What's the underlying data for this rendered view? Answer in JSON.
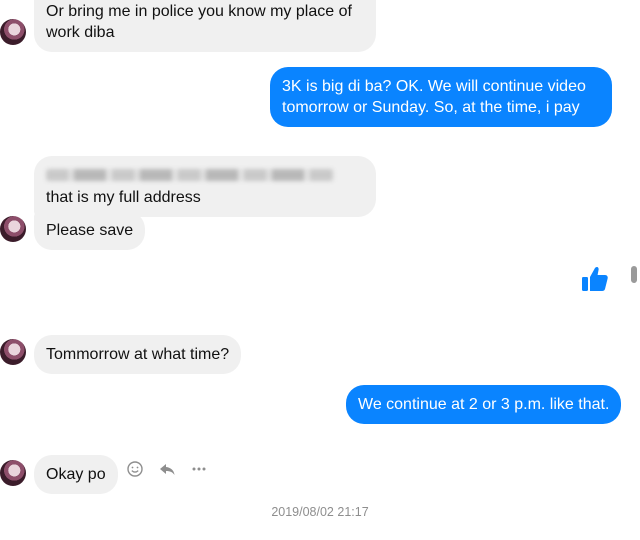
{
  "messages": {
    "m1": {
      "sender": "them",
      "text": "Or bring me in police you know my place of work diba"
    },
    "m2": {
      "sender": "me",
      "text": "3K is big di ba? OK. We will continue video tomorrow or Sunday. So, at the time, i pay"
    },
    "m3": {
      "sender": "them",
      "text": "that is my full address"
    },
    "m4": {
      "sender": "them",
      "text": "Please save"
    },
    "m5": {
      "sender": "me",
      "type": "like",
      "icon": "thumbs-up-icon"
    },
    "m6": {
      "sender": "them",
      "text": "Tommorrow at what time?"
    },
    "m7": {
      "sender": "me",
      "text": "We continue at 2 or 3 p.m. like that."
    },
    "m8": {
      "sender": "them",
      "text": "Okay po"
    }
  },
  "message_actions": {
    "react_icon": "smiley-icon",
    "reply_icon": "reply-arrow-icon",
    "more_icon": "more-dots-icon"
  },
  "timestamp": "2019/08/02 21:17",
  "colors": {
    "outgoing_bubble": "#0a84ff",
    "incoming_bubble": "#f0f0f0",
    "like_icon": "#0a84ff"
  }
}
